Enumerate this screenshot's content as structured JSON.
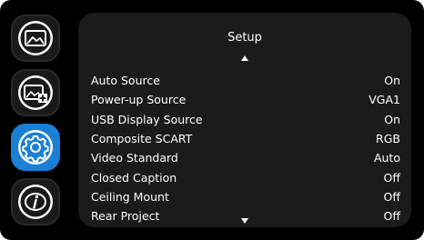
{
  "sidebar": {
    "tabs": [
      {
        "icon": "picture-icon",
        "active": false
      },
      {
        "icon": "picture-settings-icon",
        "active": false
      },
      {
        "icon": "gear-icon",
        "active": true
      },
      {
        "icon": "info-icon",
        "active": false
      }
    ]
  },
  "panel": {
    "title": "Setup",
    "items": [
      {
        "label": "Auto Source",
        "value": "On"
      },
      {
        "label": "Power-up Source",
        "value": "VGA1"
      },
      {
        "label": "USB Display Source",
        "value": "On"
      },
      {
        "label": "Composite SCART",
        "value": "RGB"
      },
      {
        "label": "Video Standard",
        "value": "Auto"
      },
      {
        "label": "Closed Caption",
        "value": "Off"
      },
      {
        "label": "Ceiling Mount",
        "value": "Off"
      },
      {
        "label": "Rear Project",
        "value": "Off"
      }
    ]
  },
  "colors": {
    "accent": "#1a80d6",
    "panel": "#1b1b1b",
    "background": "#000000"
  }
}
